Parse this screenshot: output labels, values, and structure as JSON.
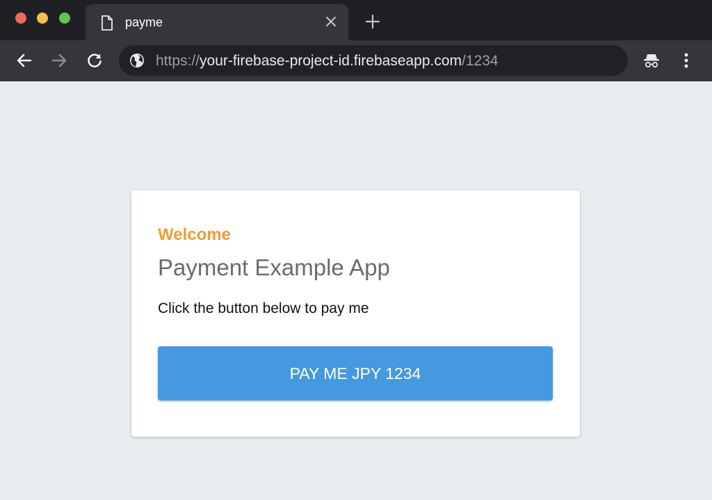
{
  "browser": {
    "tab": {
      "title": "payme"
    },
    "url": {
      "scheme": "https://",
      "host": "your-firebase-project-id.firebaseapp.com",
      "path": "/1234"
    },
    "icons": {
      "close_tab": "close-icon",
      "new_tab": "plus-icon",
      "back": "back-arrow-icon",
      "forward": "forward-arrow-icon",
      "reload": "reload-icon",
      "site_info": "globe-icon",
      "incognito": "incognito-icon",
      "menu": "kebab-menu-icon"
    }
  },
  "page": {
    "welcome": "Welcome",
    "title": "Payment Example App",
    "description": "Click the button below to pay me",
    "pay_button_label": "PAY ME JPY 1234"
  },
  "colors": {
    "accent_welcome": "#f39c34",
    "button": "#4599df",
    "page_background": "#e9ecef"
  }
}
